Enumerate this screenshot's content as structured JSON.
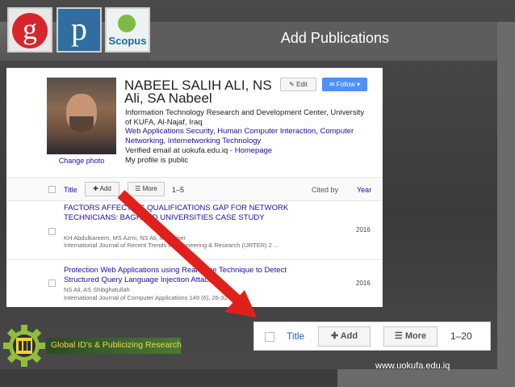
{
  "slide": {
    "title": "Add Publications",
    "tagline": "Global ID's & Publicizing Research",
    "url": "www.uokufa.edu.iq"
  },
  "logos": {
    "google_scholar": "g",
    "publons": "p",
    "scopus": "Scopus"
  },
  "profile": {
    "name": "NABEEL SALIH ALI, NS",
    "name_alt": "Ali, SA Nabeel",
    "affiliation": "Information Technology Research and Development Center, University of KUFA, Al-Najaf, Iraq",
    "interests": "Web Applications Security, Human Computer Interaction, Computer Networking, Internetworking Technology",
    "verified": "Verified email at uokufa.edu.iq - ",
    "homepage_link": "Homepage",
    "public_note": "My profile is public",
    "change_photo": "Change photo",
    "edit_label": "Edit",
    "follow_label": "Follow"
  },
  "toolbar": {
    "title_label": "Title",
    "add_label": "Add",
    "more_label": "More",
    "range": "1–5",
    "cited_by_label": "Cited by",
    "year_label": "Year"
  },
  "publications": [
    {
      "title": "FACTORS AFFECTING QUALIFICATIONS GAP FOR NETWORK TECHNICIANS: BAGHDAD UNIVERSITIES CASE STUDY",
      "authors": "KH Abdulkareem, MS Azmi, NS Ali, M Nasser",
      "venue": "International Journal of Recent Trends in Engineering & Research (IJRTER) 2 ...",
      "year": "2016"
    },
    {
      "title": "Protection Web Applications using Real-Time Technique to Detect Structured Query Language Injection Attacks",
      "authors": "NS Ali, AS Shibghatullah",
      "venue": "International Journal of Computer Applications 149 (6), 26-32",
      "year": "2016"
    }
  ],
  "zoom_toolbar": {
    "title_label": "Title",
    "add_label": "Add",
    "more_label": "More",
    "range": "1–20"
  },
  "colors": {
    "title_bar": "#5d5d5d",
    "link_blue": "#1a0dab",
    "follow_blue": "#4d90fe",
    "arrow_red": "#e0201b",
    "tagline_yellow": "#f5d64a"
  }
}
